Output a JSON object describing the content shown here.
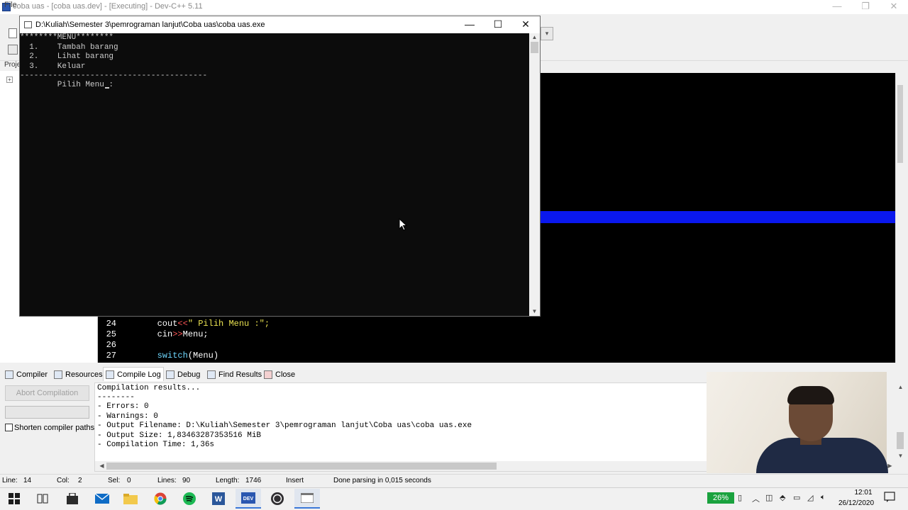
{
  "ide": {
    "title": "coba uas - [coba uas.dev] - [Executing] - Dev-C++ 5.11",
    "menu_file": "File",
    "project_tab": "Proje",
    "window_buttons": [
      "—",
      "❐",
      "✕"
    ]
  },
  "console": {
    "title": "D:\\Kuliah\\Semester 3\\pemrograman lanjut\\Coba uas\\coba uas.exe",
    "lines": [
      "********MENU********",
      "  1.    Tambah barang",
      "  2.    Lihat barang",
      "  3.    Keluar",
      "----------------------------------------",
      "        Pilih Menu :"
    ],
    "buttons": [
      "—",
      "☐",
      "✕"
    ]
  },
  "editor": {
    "lines": [
      {
        "num": "24",
        "pre": "        cout",
        "op": "<<",
        "str": "\" Pilih Menu :\";",
        "post": ""
      },
      {
        "num": "25",
        "pre": "        cin",
        "op": ">>",
        "str": "",
        "post": "Menu;"
      },
      {
        "num": "26",
        "pre": "",
        "op": "",
        "str": "",
        "post": ""
      },
      {
        "num": "27",
        "pre": "        ",
        "op": "",
        "str": "",
        "post": "(Menu)",
        "kw": "switch"
      }
    ]
  },
  "bottom_tabs": [
    {
      "label": "Compiler",
      "icon": "compiler-icon"
    },
    {
      "label": "Resources",
      "icon": "resources-icon"
    },
    {
      "label": "Compile Log",
      "icon": "compile-log-icon"
    },
    {
      "label": "Debug",
      "icon": "debug-icon"
    },
    {
      "label": "Find Results",
      "icon": "find-results-icon"
    },
    {
      "label": "Close",
      "icon": "close-icon"
    }
  ],
  "compile_panel": {
    "abort_label": "Abort Compilation",
    "shorten_label": "Shorten compiler paths",
    "log": [
      "Compilation results...",
      "--------",
      "- Errors: 0",
      "- Warnings: 0",
      "- Output Filename: D:\\Kuliah\\Semester 3\\pemrograman lanjut\\Coba uas\\coba uas.exe",
      "- Output Size: 1,83463287353516 MiB",
      "- Compilation Time: 1,36s"
    ]
  },
  "statusbar": {
    "line_label": "Line:",
    "line_value": "14",
    "col_label": "Col:",
    "col_value": "2",
    "sel_label": "Sel:",
    "sel_value": "0",
    "lines_label": "Lines:",
    "lines_value": "90",
    "length_label": "Length:",
    "length_value": "1746",
    "mode": "Insert",
    "message": "Done parsing in 0,015 seconds"
  },
  "taskbar": {
    "battery": "26%",
    "time": "12:01",
    "date": "26/12/2020",
    "accent": "#3b78d8"
  }
}
